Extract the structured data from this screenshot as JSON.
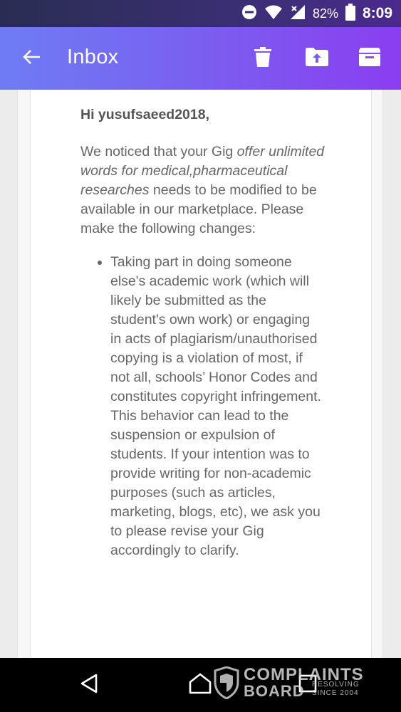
{
  "status_bar": {
    "battery": "82%",
    "time": "8:09",
    "icons": [
      "do-not-disturb-icon",
      "wifi-icon",
      "signal-icon",
      "battery-icon"
    ]
  },
  "app_bar": {
    "title": "Inbox",
    "actions": [
      "delete-icon",
      "move-to-folder-icon",
      "archive-icon"
    ]
  },
  "email": {
    "greeting": "Hi yusufsaeed2018,",
    "intro_before": "We noticed that your Gig ",
    "gig_title": "offer unlimited words for medical,pharmaceutical researches",
    "intro_after": " needs to be modified to be available in our marketplace. Please make the following changes:",
    "bullets": [
      "Taking part in doing someone else's academic work (which will likely be submitted as the student's own work) or engaging in acts of plagiarism/unauthorised copying is a violation of most, if not all, schools’ Honor Codes and constitutes copyright infringement. This behavior can lead to the suspension or expulsion of students. If your intention was to provide writing for non-academic purposes (such as articles, marketing, blogs, etc), we ask you to please revise your Gig accordingly to clarify."
    ]
  },
  "nav_bar": {
    "buttons": [
      "back-triangle-icon",
      "home-icon",
      "recents-icon"
    ]
  },
  "watermark": {
    "line1": "COMPLAINTS",
    "line2": "BOARD",
    "tag1": "RESOLVING",
    "tag2": "SINCE 2004"
  },
  "colors": {
    "app_bar_start": "#6e7cf4",
    "app_bar_end": "#8a3ef0",
    "text": "#666666"
  }
}
